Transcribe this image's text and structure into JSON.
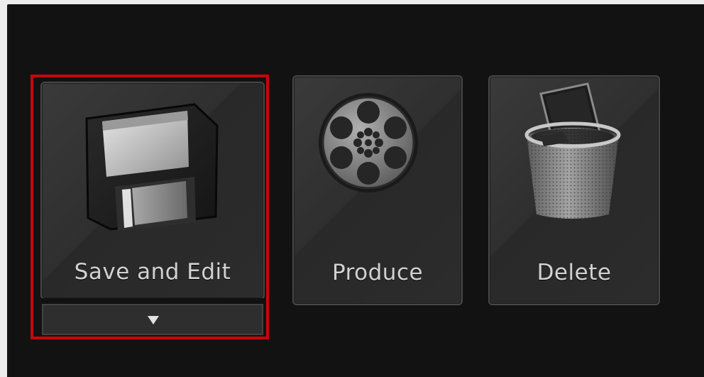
{
  "actions": {
    "save_and_edit": {
      "label": "Save and Edit",
      "icon": "floppy-disk-icon",
      "selected": true,
      "has_menu": true
    },
    "produce": {
      "label": "Produce",
      "icon": "film-reel-icon"
    },
    "delete": {
      "label": "Delete",
      "icon": "trash-can-icon"
    }
  },
  "colors": {
    "panel_bg": "#121212",
    "tile_bg": "#333333",
    "tile_border": "#474747",
    "selection": "#c8050c",
    "label_text": "#d2d2d2"
  }
}
